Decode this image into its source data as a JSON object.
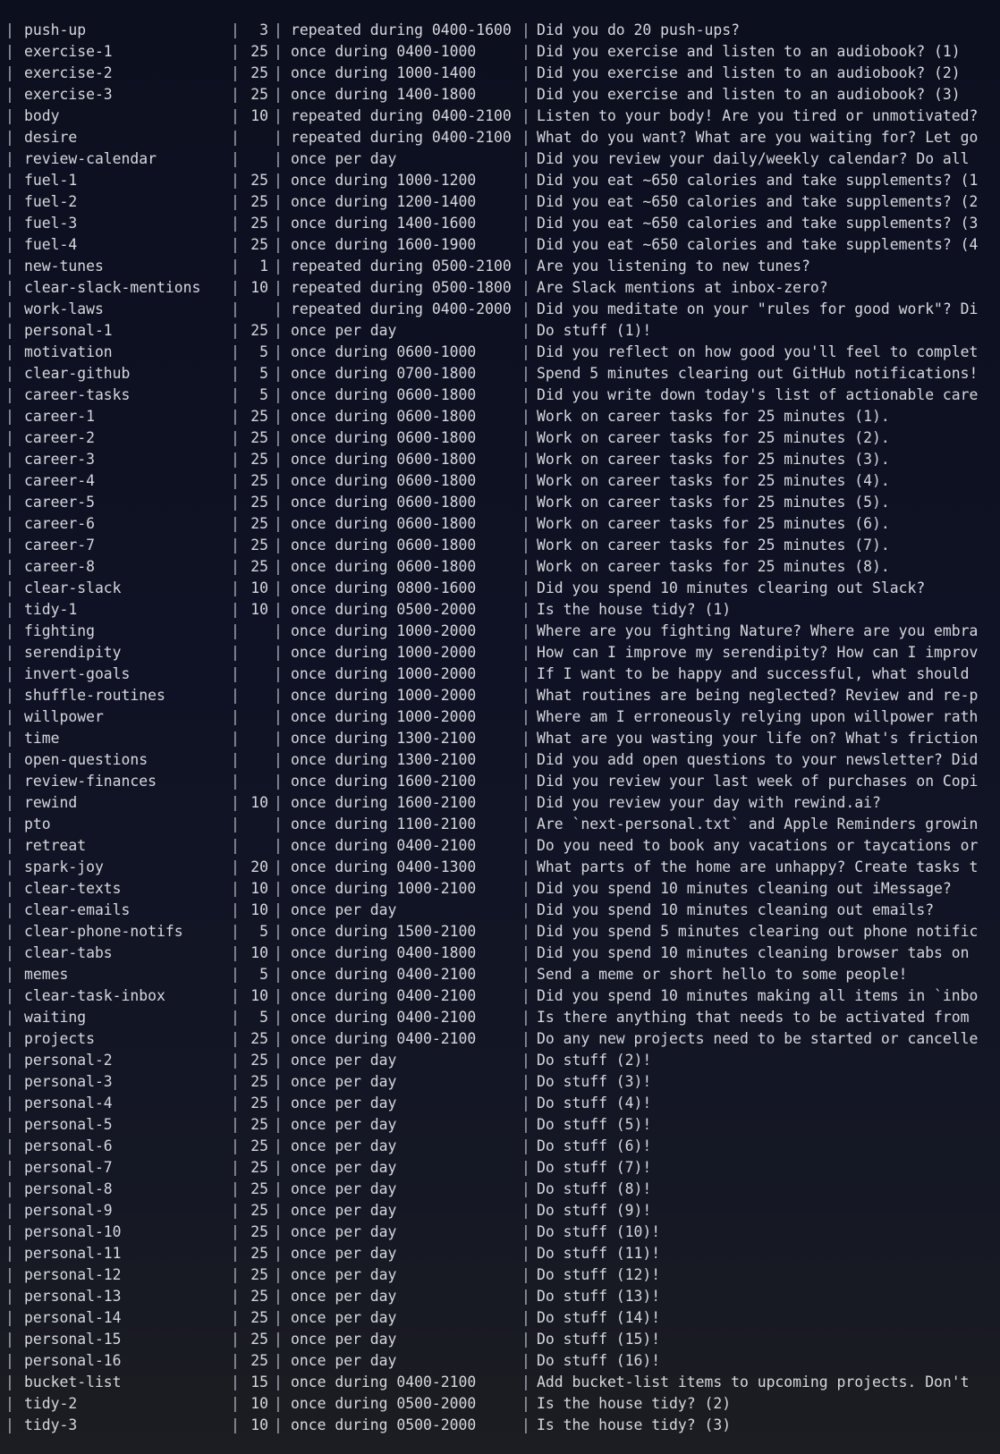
{
  "terminal": {
    "separator": "|",
    "rows": [
      {
        "name": "push-up",
        "points": "3",
        "schedule": "repeated during 0400-1600",
        "prompt": "Did you do 20 push-ups?"
      },
      {
        "name": "exercise-1",
        "points": "25",
        "schedule": "once during 0400-1000",
        "prompt": "Did you exercise and listen to an audiobook? (1)"
      },
      {
        "name": "exercise-2",
        "points": "25",
        "schedule": "once during 1000-1400",
        "prompt": "Did you exercise and listen to an audiobook? (2)"
      },
      {
        "name": "exercise-3",
        "points": "25",
        "schedule": "once during 1400-1800",
        "prompt": "Did you exercise and listen to an audiobook? (3)"
      },
      {
        "name": "body",
        "points": "10",
        "schedule": "repeated during 0400-2100",
        "prompt": "Listen to your body! Are you tired or unmotivated?"
      },
      {
        "name": "desire",
        "points": "",
        "schedule": "repeated during 0400-2100",
        "prompt": "What do you want? What are you waiting for? Let go"
      },
      {
        "name": "review-calendar",
        "points": "",
        "schedule": "once per day",
        "prompt": "Did you review your daily/weekly calendar? Do all"
      },
      {
        "name": "fuel-1",
        "points": "25",
        "schedule": "once during 1000-1200",
        "prompt": "Did you eat ~650 calories and take supplements? (1"
      },
      {
        "name": "fuel-2",
        "points": "25",
        "schedule": "once during 1200-1400",
        "prompt": "Did you eat ~650 calories and take supplements? (2"
      },
      {
        "name": "fuel-3",
        "points": "25",
        "schedule": "once during 1400-1600",
        "prompt": "Did you eat ~650 calories and take supplements? (3"
      },
      {
        "name": "fuel-4",
        "points": "25",
        "schedule": "once during 1600-1900",
        "prompt": "Did you eat ~650 calories and take supplements? (4"
      },
      {
        "name": "new-tunes",
        "points": "1",
        "schedule": "repeated during 0500-2100",
        "prompt": "Are you listening to new tunes?"
      },
      {
        "name": "clear-slack-mentions",
        "points": "10",
        "schedule": "repeated during 0500-1800",
        "prompt": "Are Slack mentions at inbox-zero?"
      },
      {
        "name": "work-laws",
        "points": "",
        "schedule": "repeated during 0400-2000",
        "prompt": "Did you meditate on your \"rules for good work\"? Di"
      },
      {
        "name": "personal-1",
        "points": "25",
        "schedule": "once per day",
        "prompt": "Do stuff (1)!"
      },
      {
        "name": "motivation",
        "points": "5",
        "schedule": "once during 0600-1000",
        "prompt": "Did you reflect on how good you'll feel to complet"
      },
      {
        "name": "clear-github",
        "points": "5",
        "schedule": "once during 0700-1800",
        "prompt": "Spend 5 minutes clearing out GitHub notifications!"
      },
      {
        "name": "career-tasks",
        "points": "5",
        "schedule": "once during 0600-1800",
        "prompt": "Did you write down today's list of actionable care"
      },
      {
        "name": "career-1",
        "points": "25",
        "schedule": "once during 0600-1800",
        "prompt": "Work on career tasks for 25 minutes (1)."
      },
      {
        "name": "career-2",
        "points": "25",
        "schedule": "once during 0600-1800",
        "prompt": "Work on career tasks for 25 minutes (2)."
      },
      {
        "name": "career-3",
        "points": "25",
        "schedule": "once during 0600-1800",
        "prompt": "Work on career tasks for 25 minutes (3)."
      },
      {
        "name": "career-4",
        "points": "25",
        "schedule": "once during 0600-1800",
        "prompt": "Work on career tasks for 25 minutes (4)."
      },
      {
        "name": "career-5",
        "points": "25",
        "schedule": "once during 0600-1800",
        "prompt": "Work on career tasks for 25 minutes (5)."
      },
      {
        "name": "career-6",
        "points": "25",
        "schedule": "once during 0600-1800",
        "prompt": "Work on career tasks for 25 minutes (6)."
      },
      {
        "name": "career-7",
        "points": "25",
        "schedule": "once during 0600-1800",
        "prompt": "Work on career tasks for 25 minutes (7)."
      },
      {
        "name": "career-8",
        "points": "25",
        "schedule": "once during 0600-1800",
        "prompt": "Work on career tasks for 25 minutes (8)."
      },
      {
        "name": "clear-slack",
        "points": "10",
        "schedule": "once during 0800-1600",
        "prompt": "Did you spend 10 minutes clearing out Slack?"
      },
      {
        "name": "tidy-1",
        "points": "10",
        "schedule": "once during 0500-2000",
        "prompt": "Is the house tidy? (1)"
      },
      {
        "name": "fighting",
        "points": "",
        "schedule": "once during 1000-2000",
        "prompt": "Where are you fighting Nature? Where are you embra"
      },
      {
        "name": "serendipity",
        "points": "",
        "schedule": "once during 1000-2000",
        "prompt": "How can I improve my serendipity? How can I improv"
      },
      {
        "name": "invert-goals",
        "points": "",
        "schedule": "once during 1000-2000",
        "prompt": "If I want to be happy and successful, what should"
      },
      {
        "name": "shuffle-routines",
        "points": "",
        "schedule": "once during 1000-2000",
        "prompt": "What routines are being neglected? Review and re-p"
      },
      {
        "name": "willpower",
        "points": "",
        "schedule": "once during 1000-2000",
        "prompt": "Where am I erroneously relying upon willpower rath"
      },
      {
        "name": "time",
        "points": "",
        "schedule": "once during 1300-2100",
        "prompt": "What are you wasting your life on? What's friction"
      },
      {
        "name": "open-questions",
        "points": "",
        "schedule": "once during 1300-2100",
        "prompt": "Did you add open questions to your newsletter? Did"
      },
      {
        "name": "review-finances",
        "points": "",
        "schedule": "once during 1600-2100",
        "prompt": "Did you review your last week of purchases on Copi"
      },
      {
        "name": "rewind",
        "points": "10",
        "schedule": "once during 1600-2100",
        "prompt": "Did you review your day with rewind.ai?"
      },
      {
        "name": "pto",
        "points": "",
        "schedule": "once during 1100-2100",
        "prompt": "Are `next-personal.txt` and Apple Reminders growin"
      },
      {
        "name": "retreat",
        "points": "",
        "schedule": "once during 0400-2100",
        "prompt": "Do you need to book any vacations or taycations or"
      },
      {
        "name": "spark-joy",
        "points": "20",
        "schedule": "once during 0400-1300",
        "prompt": "What parts of the home are unhappy? Create tasks t"
      },
      {
        "name": "clear-texts",
        "points": "10",
        "schedule": "once during 1000-2100",
        "prompt": "Did you spend 10 minutes cleaning out iMessage?"
      },
      {
        "name": "clear-emails",
        "points": "10",
        "schedule": "once per day",
        "prompt": "Did you spend 10 minutes cleaning out emails?"
      },
      {
        "name": "clear-phone-notifs",
        "points": "5",
        "schedule": "once during 1500-2100",
        "prompt": "Did you spend 5 minutes clearing out phone notific"
      },
      {
        "name": "clear-tabs",
        "points": "10",
        "schedule": "once during 0400-1800",
        "prompt": "Did you spend 10 minutes cleaning browser tabs on"
      },
      {
        "name": "memes",
        "points": "5",
        "schedule": "once during 0400-2100",
        "prompt": "Send a meme or short hello to some people!"
      },
      {
        "name": "clear-task-inbox",
        "points": "10",
        "schedule": "once during 0400-2100",
        "prompt": "Did you spend 10 minutes making all items in `inbo"
      },
      {
        "name": "waiting",
        "points": "5",
        "schedule": "once during 0400-2100",
        "prompt": "Is there anything that needs to be activated from"
      },
      {
        "name": "projects",
        "points": "25",
        "schedule": "once during 0400-2100",
        "prompt": "Do any new projects need to be started or cancelle"
      },
      {
        "name": "personal-2",
        "points": "25",
        "schedule": "once per day",
        "prompt": "Do stuff (2)!"
      },
      {
        "name": "personal-3",
        "points": "25",
        "schedule": "once per day",
        "prompt": "Do stuff (3)!"
      },
      {
        "name": "personal-4",
        "points": "25",
        "schedule": "once per day",
        "prompt": "Do stuff (4)!"
      },
      {
        "name": "personal-5",
        "points": "25",
        "schedule": "once per day",
        "prompt": "Do stuff (5)!"
      },
      {
        "name": "personal-6",
        "points": "25",
        "schedule": "once per day",
        "prompt": "Do stuff (6)!"
      },
      {
        "name": "personal-7",
        "points": "25",
        "schedule": "once per day",
        "prompt": "Do stuff (7)!"
      },
      {
        "name": "personal-8",
        "points": "25",
        "schedule": "once per day",
        "prompt": "Do stuff (8)!"
      },
      {
        "name": "personal-9",
        "points": "25",
        "schedule": "once per day",
        "prompt": "Do stuff (9)!"
      },
      {
        "name": "personal-10",
        "points": "25",
        "schedule": "once per day",
        "prompt": "Do stuff (10)!"
      },
      {
        "name": "personal-11",
        "points": "25",
        "schedule": "once per day",
        "prompt": "Do stuff (11)!"
      },
      {
        "name": "personal-12",
        "points": "25",
        "schedule": "once per day",
        "prompt": "Do stuff (12)!"
      },
      {
        "name": "personal-13",
        "points": "25",
        "schedule": "once per day",
        "prompt": "Do stuff (13)!"
      },
      {
        "name": "personal-14",
        "points": "25",
        "schedule": "once per day",
        "prompt": "Do stuff (14)!"
      },
      {
        "name": "personal-15",
        "points": "25",
        "schedule": "once per day",
        "prompt": "Do stuff (15)!"
      },
      {
        "name": "personal-16",
        "points": "25",
        "schedule": "once per day",
        "prompt": "Do stuff (16)!"
      },
      {
        "name": "bucket-list",
        "points": "15",
        "schedule": "once during 0400-2100",
        "prompt": "Add bucket-list items to upcoming projects. Don't"
      },
      {
        "name": "tidy-2",
        "points": "10",
        "schedule": "once during 0500-2000",
        "prompt": "Is the house tidy? (2)"
      },
      {
        "name": "tidy-3",
        "points": "10",
        "schedule": "once during 0500-2000",
        "prompt": "Is the house tidy? (3)"
      }
    ]
  }
}
